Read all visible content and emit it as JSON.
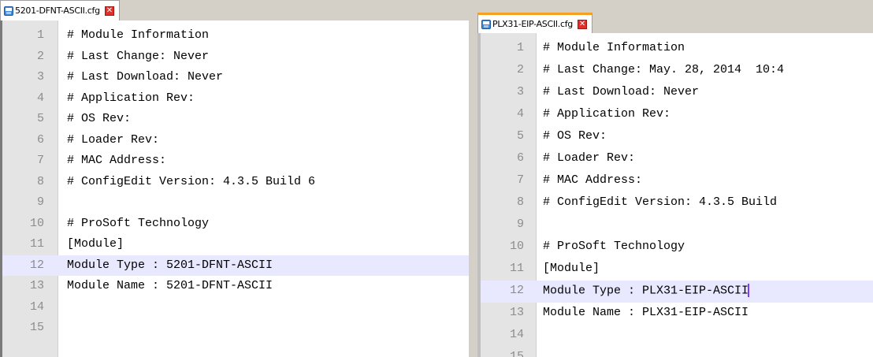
{
  "left_editor": {
    "tab_title": "5201-DFNT-ASCII.cfg",
    "current_line": 12,
    "lines": [
      {
        "no": "1",
        "text": "# Module Information"
      },
      {
        "no": "2",
        "text": "# Last Change: Never"
      },
      {
        "no": "3",
        "text": "# Last Download: Never"
      },
      {
        "no": "4",
        "text": "# Application Rev:"
      },
      {
        "no": "5",
        "text": "# OS Rev:"
      },
      {
        "no": "6",
        "text": "# Loader Rev:"
      },
      {
        "no": "7",
        "text": "# MAC Address:"
      },
      {
        "no": "8",
        "text": "# ConfigEdit Version: 4.3.5 Build 6"
      },
      {
        "no": "9",
        "text": ""
      },
      {
        "no": "10",
        "text": "# ProSoft Technology"
      },
      {
        "no": "11",
        "text": "[Module]"
      },
      {
        "no": "12",
        "text": "Module Type : 5201-DFNT-ASCII"
      },
      {
        "no": "13",
        "text": "Module Name : 5201-DFNT-ASCII"
      },
      {
        "no": "14",
        "text": ""
      },
      {
        "no": "15",
        "text": ""
      }
    ]
  },
  "right_editor": {
    "tab_title": "PLX31-EIP-ASCII.cfg",
    "current_line": 12,
    "lines": [
      {
        "no": "1",
        "text": "# Module Information"
      },
      {
        "no": "2",
        "text": "# Last Change: May. 28, 2014  10:4"
      },
      {
        "no": "3",
        "text": "# Last Download: Never"
      },
      {
        "no": "4",
        "text": "# Application Rev:"
      },
      {
        "no": "5",
        "text": "# OS Rev:"
      },
      {
        "no": "6",
        "text": "# Loader Rev:"
      },
      {
        "no": "7",
        "text": "# MAC Address:"
      },
      {
        "no": "8",
        "text": "# ConfigEdit Version: 4.3.5 Build"
      },
      {
        "no": "9",
        "text": ""
      },
      {
        "no": "10",
        "text": "# ProSoft Technology"
      },
      {
        "no": "11",
        "text": "[Module]"
      },
      {
        "no": "12",
        "text": "Module Type : PLX31-EIP-ASCII"
      },
      {
        "no": "13",
        "text": "Module Name : PLX31-EIP-ASCII"
      },
      {
        "no": "14",
        "text": ""
      },
      {
        "no": "15",
        "text": ""
      }
    ]
  },
  "icons": {
    "tab_icon": "save-disk-icon",
    "tab_close": "close-icon"
  },
  "colors": {
    "current_line_bg": "#e8e8ff",
    "active_tab_accent": "#f5a020",
    "close_button": "#e0302a"
  }
}
